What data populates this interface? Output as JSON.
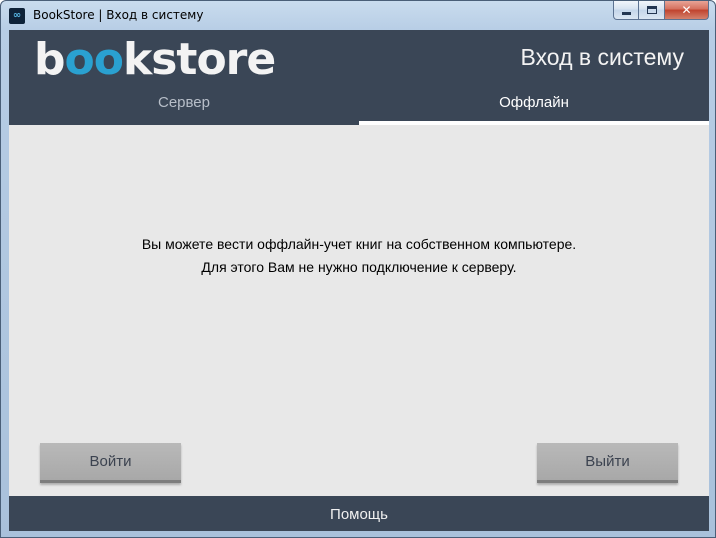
{
  "window": {
    "title": "BookStore | Вход в систему",
    "app_icon": "∞",
    "close_glyph": "✕"
  },
  "header": {
    "logo_prefix": "b",
    "logo_accent": "oo",
    "logo_suffix": "kstore",
    "heading": "Вход в систему"
  },
  "tabs": [
    {
      "label": "Сервер",
      "active": false
    },
    {
      "label": "Оффлайн",
      "active": true
    }
  ],
  "main": {
    "message_line1": "Вы можете вести оффлайн-учет книг на собственном компьютере.",
    "message_line2": "Для этого Вам не нужно подключение к серверу."
  },
  "buttons": {
    "login": "Войти",
    "exit": "Выйти"
  },
  "footer": {
    "help": "Помощь"
  },
  "colors": {
    "header_bg": "#3a4656",
    "accent": "#2aa1d1",
    "content_bg": "#e8e8e8",
    "button_bg": "#b0b0b0"
  }
}
